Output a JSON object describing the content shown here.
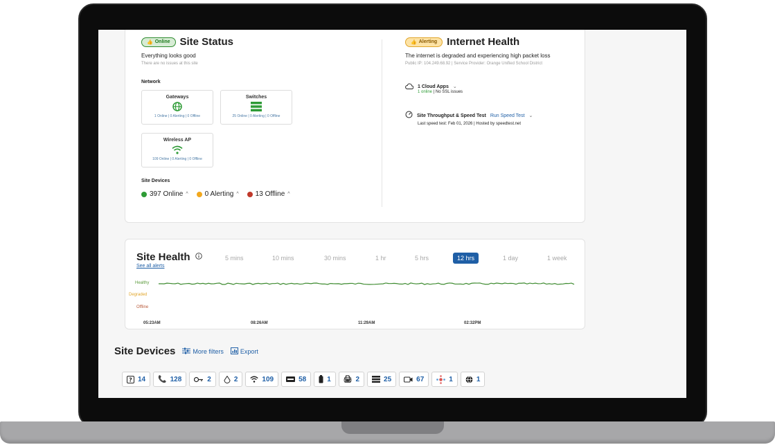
{
  "site_status": {
    "badge": "Online",
    "title": "Site Status",
    "summary": "Everything looks good",
    "detail": "There are no issues at this site",
    "network_label": "Network",
    "tiles": [
      {
        "name": "Gateways",
        "stats": "1 Online | 0 Alerting | 0 Offline",
        "icon": "globe-icon"
      },
      {
        "name": "Switches",
        "stats": "25 Online | 0 Alerting | 0 Offline",
        "icon": "switch-icon"
      },
      {
        "name": "Wireless AP",
        "stats": "109 Online | 0 Alerting | 0 Offline",
        "icon": "wifi-icon"
      }
    ],
    "site_devices_label": "Site Devices",
    "counts": [
      {
        "label": "397 Online",
        "color": "#2e9b36"
      },
      {
        "label": "0 Alerting",
        "color": "#f2a81d"
      },
      {
        "label": "13 Offline",
        "color": "#c0392b"
      }
    ]
  },
  "internet_health": {
    "badge": "Alerting",
    "title": "Internet Health",
    "summary": "The internet is degraded and experiencing high packet loss",
    "detail": "Public IP: 104.249.68.92 | Service Provider: Orange Unified School District",
    "cloud_apps": {
      "label": "1 Cloud Apps",
      "online": "1 online",
      "ssl": " | No SSL issues"
    },
    "throughput": {
      "label": "Site Throughput & Speed Test",
      "link": "Run Speed Test",
      "detail": "Last speed test: Feb 01, 2026 | Hosted by speedtest.net"
    }
  },
  "site_health": {
    "title": "Site Health",
    "see_all": "See all alerts",
    "ranges": [
      "5 mins",
      "10 mins",
      "30 mins",
      "1 hr",
      "5 hrs",
      "12 hrs",
      "1 day",
      "1 week"
    ],
    "active_range": "12 hrs",
    "levels": [
      {
        "label": "Healthy",
        "color": "#5a9a3a"
      },
      {
        "label": "Degraded",
        "color": "#e0a52a"
      },
      {
        "label": "Offline",
        "color": "#b85a3a"
      }
    ],
    "ticks": [
      "05:23AM",
      "08:26AM",
      "11:29AM",
      "02:32PM"
    ],
    "line_color": "#3c8a2e"
  },
  "site_devices": {
    "title": "Site Devices",
    "more_filters": "More filters",
    "export": "Export",
    "chips": [
      {
        "icon": "unknown-device-icon",
        "count": "14"
      },
      {
        "icon": "phone-icon",
        "count": "128"
      },
      {
        "icon": "key-icon",
        "count": "2"
      },
      {
        "icon": "sensor-icon",
        "count": "2"
      },
      {
        "icon": "wifi-icon",
        "count": "109"
      },
      {
        "icon": "ups-icon",
        "count": "58"
      },
      {
        "icon": "battery-icon",
        "count": "1"
      },
      {
        "icon": "printer-icon",
        "count": "2"
      },
      {
        "icon": "switch-icon",
        "count": "25"
      },
      {
        "icon": "camera-icon",
        "count": "67"
      },
      {
        "icon": "hub-icon",
        "count": "1"
      },
      {
        "icon": "globe-icon",
        "count": "1"
      }
    ]
  }
}
